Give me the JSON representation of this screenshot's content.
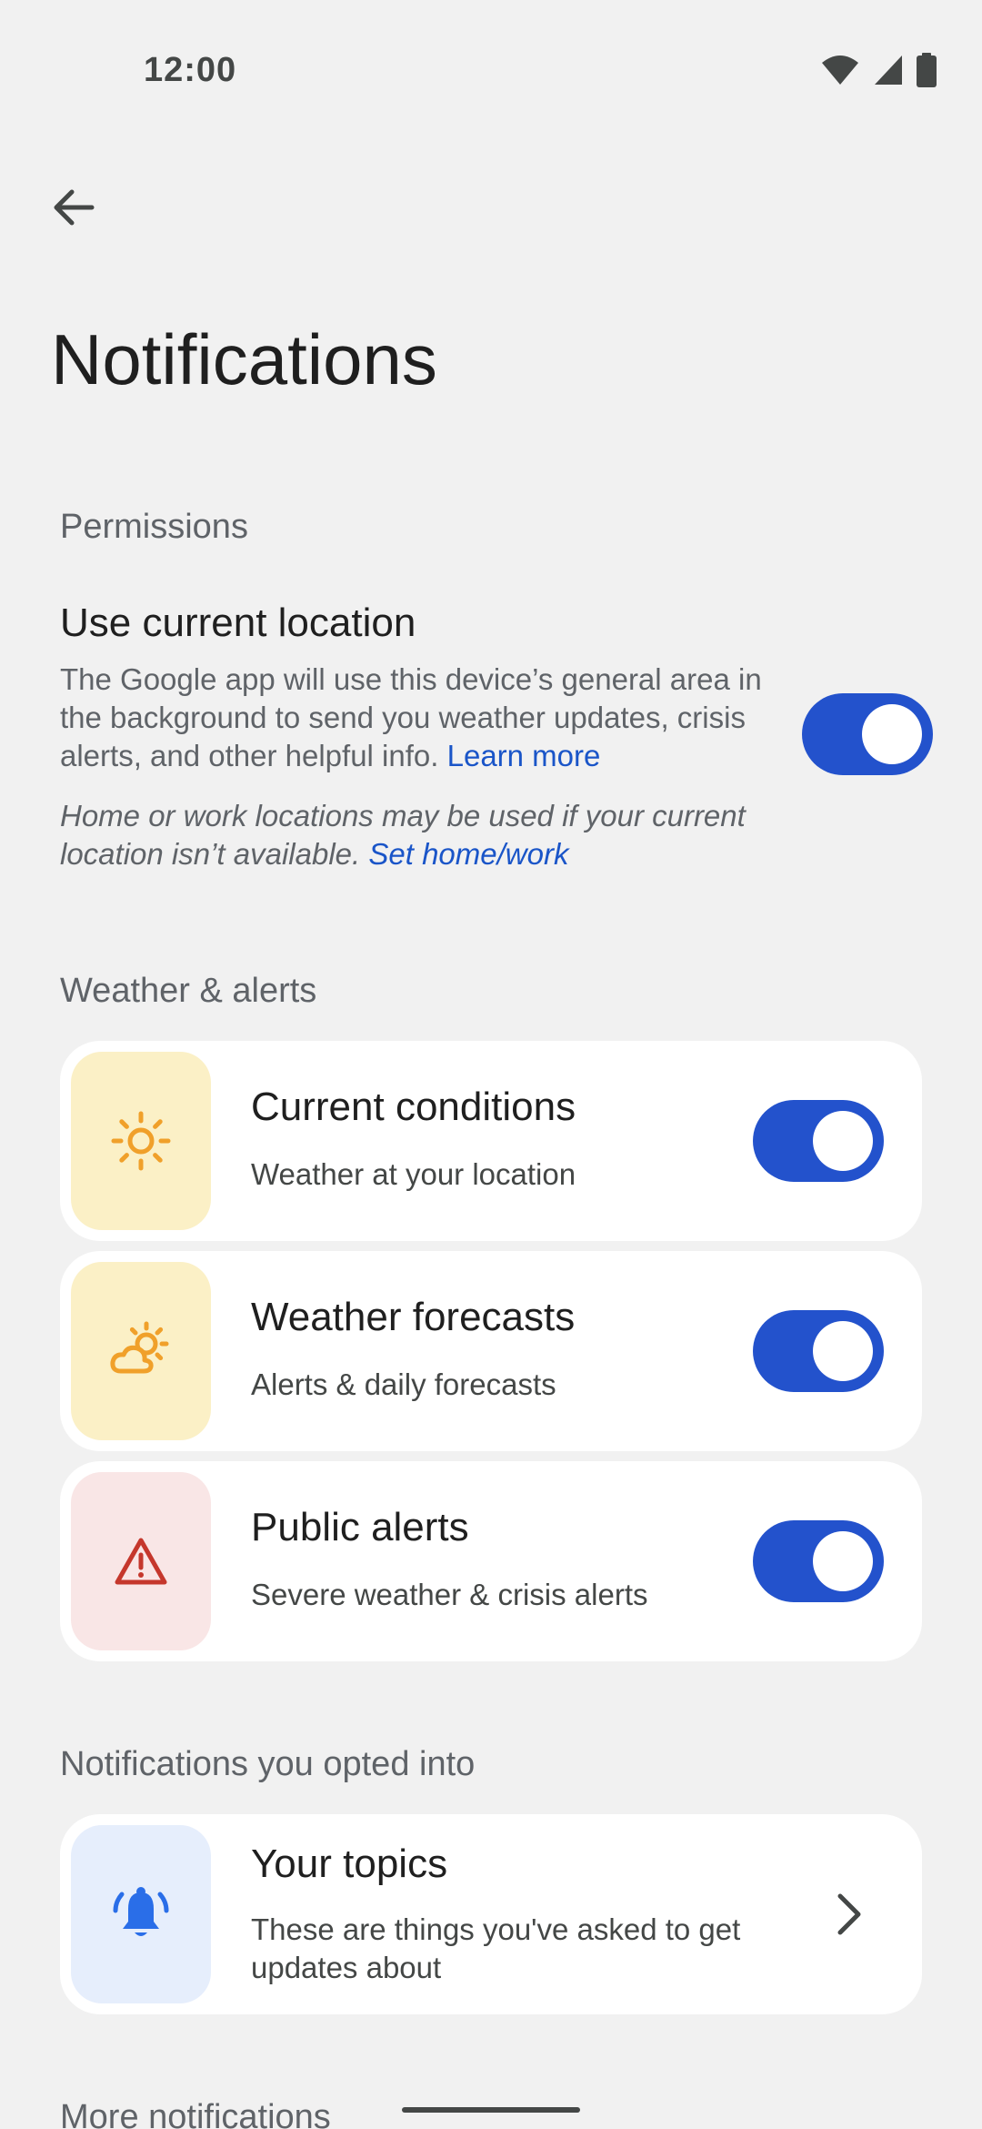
{
  "status_bar": {
    "time": "12:00"
  },
  "header": {
    "title": "Notifications"
  },
  "permissions": {
    "section_label": "Permissions",
    "location": {
      "title": "Use current location",
      "description": "The Google app will use this device’s general area in the background to send you weather updates, crisis alerts, and other helpful info.",
      "learn_more": "Learn more",
      "note": "Home or work locations may be used if your current location isn’t available.",
      "set_home_work": "Set home/work",
      "enabled": true
    }
  },
  "weather_alerts": {
    "section_label": "Weather & alerts",
    "items": [
      {
        "title": "Current conditions",
        "subtitle": "Weather at your location",
        "icon": "sun-icon",
        "enabled": true
      },
      {
        "title": "Weather forecasts",
        "subtitle": "Alerts & daily forecasts",
        "icon": "partly-cloudy-icon",
        "enabled": true
      },
      {
        "title": "Public alerts",
        "subtitle": "Severe weather & crisis alerts",
        "icon": "warning-icon",
        "enabled": true
      }
    ]
  },
  "opted_in": {
    "section_label": "Notifications you opted into",
    "topics": {
      "title": "Your topics",
      "subtitle": "These are things you've asked to get updates about",
      "icon": "bell-icon"
    }
  },
  "more": {
    "section_label": "More notifications"
  },
  "colors": {
    "accent": "#2352cc",
    "link": "#1a55c8",
    "sun_bg": "#fbf0c6",
    "sun_icon": "#f0a02a",
    "alert_bg": "#f9e6e6",
    "alert_icon": "#c5372c",
    "bell_bg": "#e6eefc",
    "bell_icon": "#2a6ee8"
  }
}
